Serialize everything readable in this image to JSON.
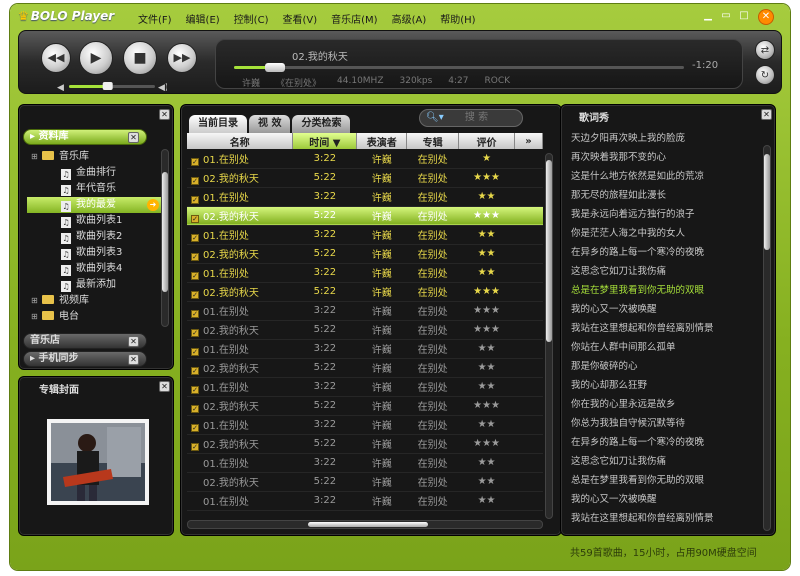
{
  "app": {
    "title": "BOLO Player"
  },
  "menu": [
    "文件(F)",
    "编辑(E)",
    "控制(C)",
    "查看(V)",
    "音乐店(M)",
    "高级(A)",
    "帮助(H)"
  ],
  "player": {
    "now_playing": "02.我的秋天",
    "remaining": "-1:20",
    "info": [
      "许巍",
      "《在别处》",
      "44.10MHZ",
      "320kps",
      "4:27",
      "ROCK"
    ],
    "progress": 0.09,
    "volume": 0.45
  },
  "library": {
    "header": "资料库",
    "items": [
      {
        "label": "音乐库",
        "kind": "folder",
        "level": 0
      },
      {
        "label": "金曲排行",
        "kind": "list",
        "level": 1
      },
      {
        "label": "年代音乐",
        "kind": "list",
        "level": 1
      },
      {
        "label": "我的最爱",
        "kind": "list",
        "level": 1,
        "selected": true
      },
      {
        "label": "歌曲列表1",
        "kind": "list",
        "level": 1
      },
      {
        "label": "歌曲列表2",
        "kind": "list",
        "level": 1
      },
      {
        "label": "歌曲列表3",
        "kind": "list",
        "level": 1
      },
      {
        "label": "歌曲列表4",
        "kind": "list",
        "level": 1
      },
      {
        "label": "最新添加",
        "kind": "list",
        "level": 1
      },
      {
        "label": "视频库",
        "kind": "folder",
        "level": 0
      },
      {
        "label": "电台",
        "kind": "folder",
        "level": 0
      }
    ],
    "store": "音乐店",
    "sync": "手机同步"
  },
  "album": {
    "title": "专辑封面"
  },
  "playlist": {
    "tabs": [
      "当前目录",
      "视 效",
      "分类检索"
    ],
    "search_placeholder": "搜 索",
    "columns": [
      "名称",
      "时间",
      "表演者",
      "专辑",
      "评价"
    ],
    "rows": [
      {
        "name": "01.在别处",
        "time": "3:22",
        "artist": "许巍",
        "album": "在别处",
        "rating": "★",
        "style": "y",
        "checked": true
      },
      {
        "name": "02.我的秋天",
        "time": "5:22",
        "artist": "许巍",
        "album": "在别处",
        "rating": "★★★",
        "style": "y",
        "checked": true
      },
      {
        "name": "01.在别处",
        "time": "3:22",
        "artist": "许巍",
        "album": "在别处",
        "rating": "★★",
        "style": "y",
        "checked": true
      },
      {
        "name": "02.我的秋天",
        "time": "5:22",
        "artist": "许巍",
        "album": "在别处",
        "rating": "★★★",
        "style": "s",
        "checked": true
      },
      {
        "name": "01.在别处",
        "time": "3:22",
        "artist": "许巍",
        "album": "在别处",
        "rating": "★★",
        "style": "y",
        "checked": true
      },
      {
        "name": "02.我的秋天",
        "time": "5:22",
        "artist": "许巍",
        "album": "在别处",
        "rating": "★★",
        "style": "y",
        "checked": true
      },
      {
        "name": "01.在别处",
        "time": "3:22",
        "artist": "许巍",
        "album": "在别处",
        "rating": "★★",
        "style": "y",
        "checked": true
      },
      {
        "name": "02.我的秋天",
        "time": "5:22",
        "artist": "许巍",
        "album": "在别处",
        "rating": "★★★",
        "style": "y",
        "checked": true
      },
      {
        "name": "01.在别处",
        "time": "3:22",
        "artist": "许巍",
        "album": "在别处",
        "rating": "★★★",
        "style": "g",
        "checked": true
      },
      {
        "name": "02.我的秋天",
        "time": "5:22",
        "artist": "许巍",
        "album": "在别处",
        "rating": "★★★",
        "style": "g",
        "checked": true
      },
      {
        "name": "01.在别处",
        "time": "3:22",
        "artist": "许巍",
        "album": "在别处",
        "rating": "★★",
        "style": "g",
        "checked": true
      },
      {
        "name": "02.我的秋天",
        "time": "5:22",
        "artist": "许巍",
        "album": "在别处",
        "rating": "★★",
        "style": "g",
        "checked": true
      },
      {
        "name": "01.在别处",
        "time": "3:22",
        "artist": "许巍",
        "album": "在别处",
        "rating": "★★",
        "style": "g",
        "checked": true
      },
      {
        "name": "02.我的秋天",
        "time": "5:22",
        "artist": "许巍",
        "album": "在别处",
        "rating": "★★★",
        "style": "g",
        "checked": true
      },
      {
        "name": "01.在别处",
        "time": "3:22",
        "artist": "许巍",
        "album": "在别处",
        "rating": "★★",
        "style": "g",
        "checked": true
      },
      {
        "name": "02.我的秋天",
        "time": "5:22",
        "artist": "许巍",
        "album": "在别处",
        "rating": "★★★",
        "style": "g",
        "checked": true
      },
      {
        "name": "01.在别处",
        "time": "3:22",
        "artist": "许巍",
        "album": "在别处",
        "rating": "★★",
        "style": "g",
        "checked": false
      },
      {
        "name": "02.我的秋天",
        "time": "5:22",
        "artist": "许巍",
        "album": "在别处",
        "rating": "★★",
        "style": "g",
        "checked": false
      },
      {
        "name": "01.在别处",
        "time": "3:22",
        "artist": "许巍",
        "album": "在别处",
        "rating": "★★",
        "style": "g",
        "checked": false
      }
    ]
  },
  "lyrics": {
    "title": "歌词秀",
    "lines": [
      "天边夕阳再次映上我的脸庞",
      "再次映着我那不变的心",
      "这是什么地方依然是如此的荒凉",
      "那无尽的旅程如此漫长",
      "我是永远向着远方独行的浪子",
      "你是茫茫人海之中我的女人",
      "在异乡的路上每一个寒冷的夜晚",
      "这思念它如刀让我伤痛",
      "总是在梦里我看到你无助的双眼",
      "我的心又一次被唤醒",
      "我站在这里想起和你曾经离别情景",
      "你站在人群中间那么孤单",
      "那是你破碎的心",
      "我的心却那么狂野",
      "你在我的心里永远是故乡",
      "你总为我独自守候沉默等待",
      "在异乡的路上每一个寒冷的夜晚",
      "这思念它如刀让我伤痛",
      "总是在梦里我看到你无助的双眼",
      "我的心又一次被唤醒",
      "我站在这里想起和你曾经离别情景"
    ],
    "highlight": 8
  },
  "status": "共59首歌曲，15小时，占用90M硬盘空间"
}
